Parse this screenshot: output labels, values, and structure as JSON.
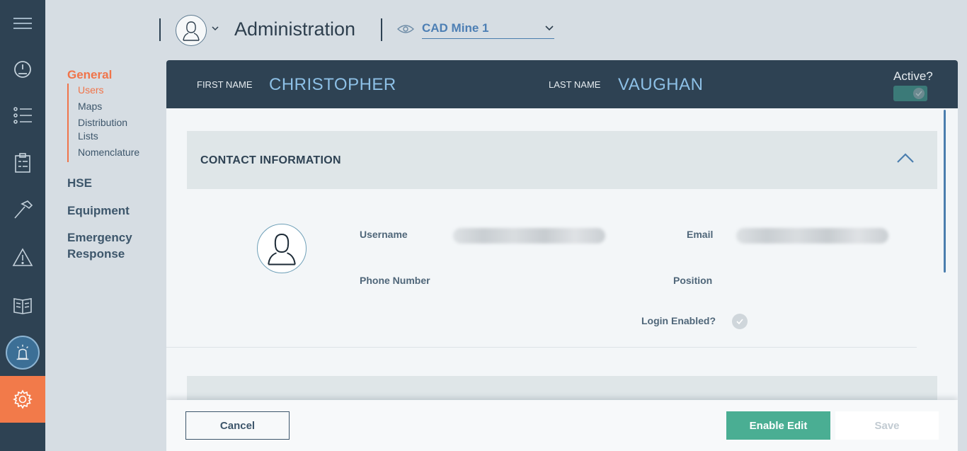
{
  "rail": {
    "items": [
      {
        "icon": "menu-icon"
      },
      {
        "icon": "dashboard-gauge-icon"
      },
      {
        "icon": "checklist-icon"
      },
      {
        "icon": "clipboard-icon"
      },
      {
        "icon": "hammer-icon"
      },
      {
        "icon": "warning-icon"
      },
      {
        "icon": "book-icon"
      },
      {
        "icon": "alarm-beacon-icon"
      },
      {
        "icon": "settings-gear-icon",
        "active": true
      }
    ]
  },
  "nav": {
    "sections": [
      "General",
      "HSE",
      "Equipment",
      "Emergency Response"
    ],
    "general_items": [
      "Users",
      "Maps",
      "Distribution Lists",
      "Nomenclature"
    ],
    "current_section": "General",
    "current_item": "Users"
  },
  "header": {
    "title": "Administration",
    "site": "CAD Mine 1"
  },
  "user": {
    "first_name_label": "FIRST NAME",
    "first_name": "CHRISTOPHER",
    "last_name_label": "LAST NAME",
    "last_name": "VAUGHAN",
    "active_label": "Active?"
  },
  "contact": {
    "title": "CONTACT INFORMATION",
    "username_label": "Username",
    "email_label": "Email",
    "phone_label": "Phone Number",
    "position_label": "Position",
    "login_label": "Login Enabled?"
  },
  "footer": {
    "cancel": "Cancel",
    "enable_edit": "Enable Edit",
    "save": "Save"
  },
  "colors": {
    "rail_bg": "#2e4253",
    "accent_orange": "#f27a4a",
    "accent_teal": "#4aae93",
    "link_blue": "#4d7fb4",
    "name_blue": "#8dc0e6"
  }
}
